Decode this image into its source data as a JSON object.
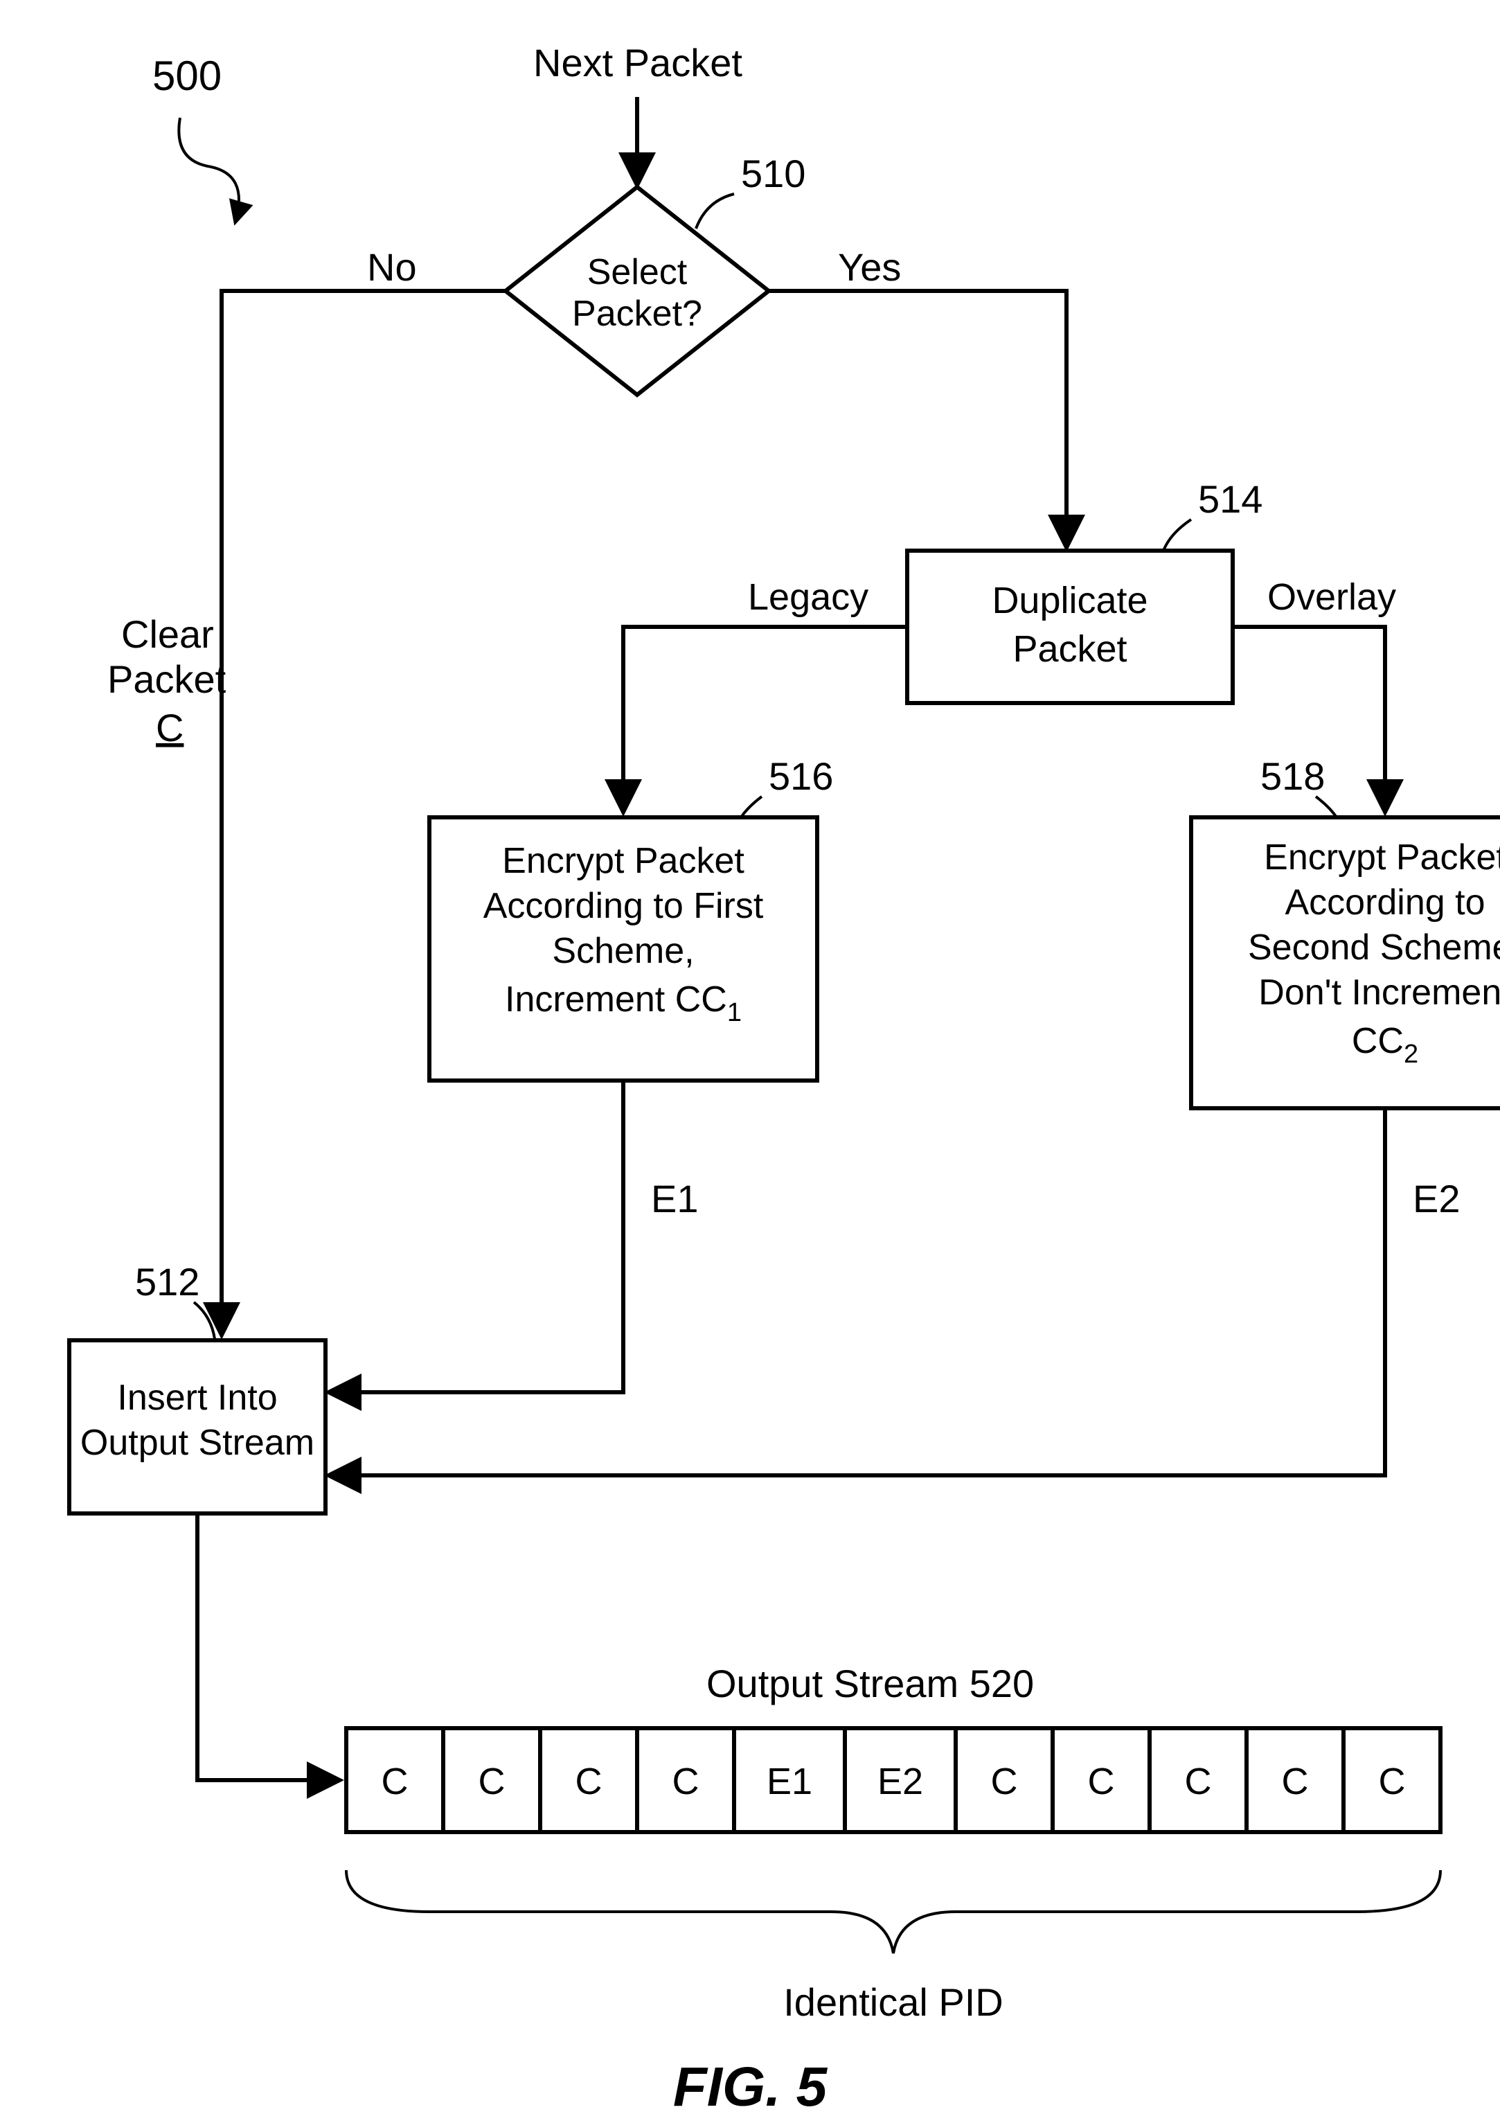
{
  "figure": {
    "ref_500": "500",
    "ref_510": "510",
    "ref_512": "512",
    "ref_514": "514",
    "ref_516": "516",
    "ref_518": "518",
    "ref_520": "520",
    "top_label": "Next Packet",
    "decision_l1": "Select",
    "decision_l2": "Packet?",
    "no": "No",
    "yes": "Yes",
    "clear_l1": "Clear",
    "clear_l2": "Packet",
    "clear_l3": "C",
    "dup_l1": "Duplicate",
    "dup_l2": "Packet",
    "legacy": "Legacy",
    "overlay": "Overlay",
    "b516_l1": "Encrypt Packet",
    "b516_l2": "According to First",
    "b516_l3": "Scheme,",
    "b516_l4a": "Increment CC",
    "b516_l4b": "1",
    "b518_l1": "Encrypt Packet",
    "b518_l2": "According to",
    "b518_l3": "Second Scheme,",
    "b518_l4": "Don't Increment",
    "b518_l5a": "CC",
    "b518_l5b": "2",
    "e1": "E1",
    "e2": "E2",
    "insert_l1": "Insert Into",
    "insert_l2": "Output Stream",
    "out_title": "Output Stream",
    "pid": "Identical PID",
    "cells": [
      "C",
      "C",
      "C",
      "C",
      "E1",
      "E2",
      "C",
      "C",
      "C",
      "C",
      "C"
    ],
    "fig_caption": "FIG. 5"
  }
}
